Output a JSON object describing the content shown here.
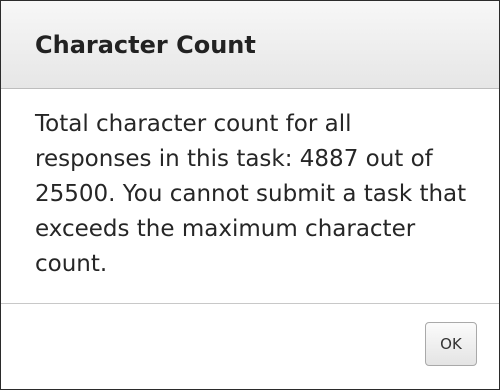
{
  "dialog": {
    "title": "Character Count",
    "message": "Total character count for all responses in this task: 4887 out of 25500. You cannot submit a task that exceeds the maximum character count.",
    "ok_label": "OK"
  }
}
